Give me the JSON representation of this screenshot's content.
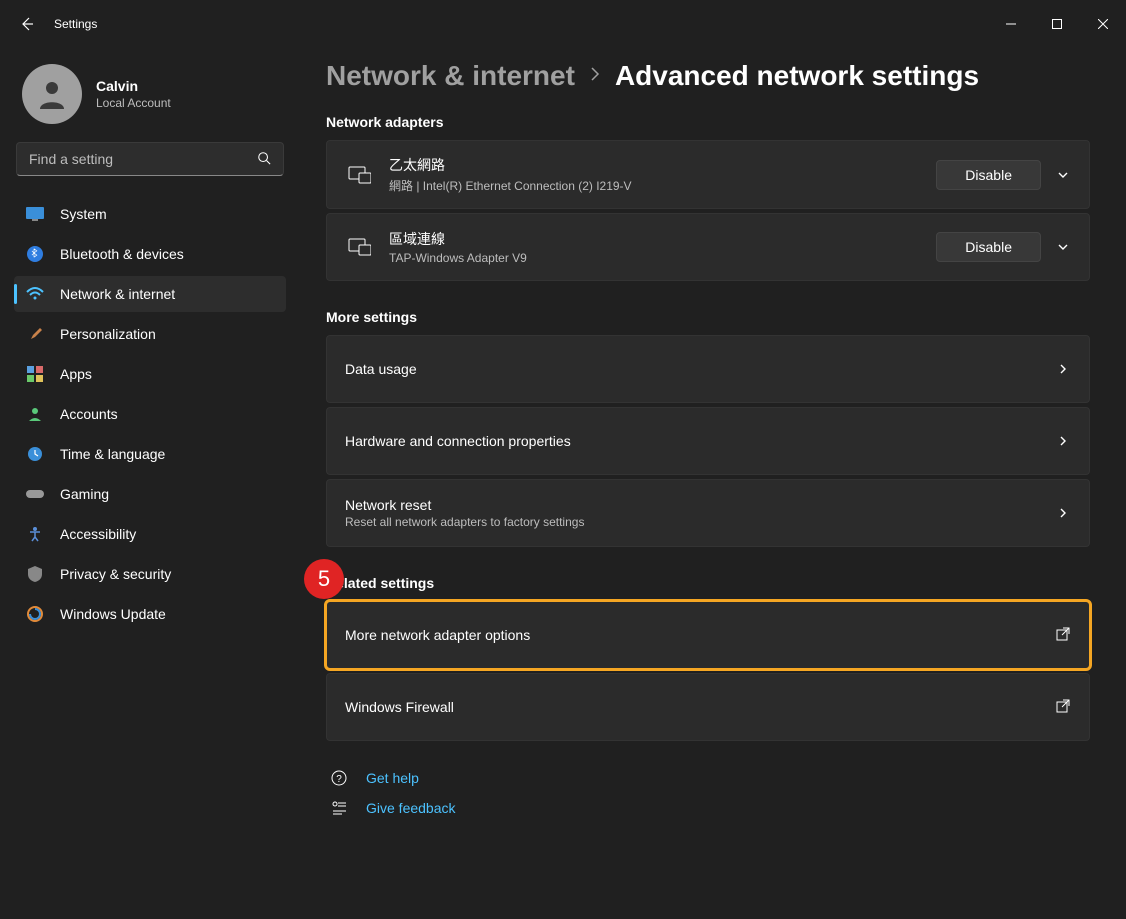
{
  "app": {
    "title": "Settings"
  },
  "user": {
    "name": "Calvin",
    "sub": "Local Account"
  },
  "search": {
    "placeholder": "Find a setting"
  },
  "nav": {
    "system": "System",
    "bluetooth": "Bluetooth & devices",
    "network": "Network & internet",
    "personalization": "Personalization",
    "apps": "Apps",
    "accounts": "Accounts",
    "time": "Time & language",
    "gaming": "Gaming",
    "accessibility": "Accessibility",
    "privacy": "Privacy & security",
    "update": "Windows Update"
  },
  "breadcrumb": {
    "parent": "Network & internet",
    "current": "Advanced network settings"
  },
  "sections": {
    "adapters": {
      "title": "Network adapters",
      "items": [
        {
          "title": "乙太網路",
          "sub": "網路 | Intel(R) Ethernet Connection (2) I219-V",
          "action": "Disable"
        },
        {
          "title": "區域連線",
          "sub": "TAP-Windows Adapter V9",
          "action": "Disable"
        }
      ]
    },
    "more": {
      "title": "More settings",
      "data_usage": "Data usage",
      "hardware": "Hardware and connection properties",
      "reset_title": "Network reset",
      "reset_sub": "Reset all network adapters to factory settings"
    },
    "related": {
      "title": "Related settings",
      "more_options": "More network adapter options",
      "firewall": "Windows Firewall"
    }
  },
  "help": {
    "get_help": "Get help",
    "feedback": "Give feedback"
  },
  "annotation": {
    "step": "5"
  }
}
